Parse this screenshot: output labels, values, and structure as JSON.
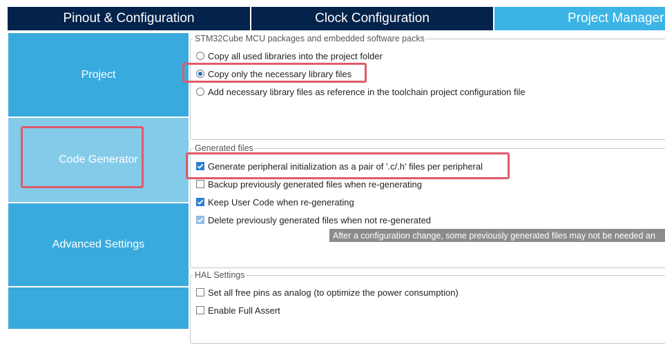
{
  "tabs": {
    "pinout": "Pinout & Configuration",
    "clock": "Clock Configuration",
    "project_manager": "Project Manager"
  },
  "sidebar": {
    "items": [
      {
        "label": "Project"
      },
      {
        "label": "Code Generator"
      },
      {
        "label": "Advanced Settings"
      },
      {
        "label": ""
      }
    ]
  },
  "packages": {
    "legend": "STM32Cube MCU packages and embedded software packs",
    "options": [
      {
        "label": "Copy all used libraries into the project folder",
        "selected": false
      },
      {
        "label": "Copy only the necessary library files",
        "selected": true
      },
      {
        "label": "Add necessary library files as reference in the toolchain project configuration file",
        "selected": false
      }
    ]
  },
  "generated_files": {
    "legend": "Generated files",
    "options": [
      {
        "label": "Generate peripheral initialization as a pair of '.c/.h' files per peripheral",
        "checked": true
      },
      {
        "label": "Backup previously generated files when re-generating",
        "checked": false
      },
      {
        "label": "Keep User Code when re-generating",
        "checked": true
      },
      {
        "label": "Delete previously generated files when not re-generated",
        "checked": true
      }
    ],
    "tooltip": "After a configuration change, some previously generated files may not be needed an"
  },
  "hal_settings": {
    "legend": "HAL Settings",
    "options": [
      {
        "label": "Set all free pins as analog (to optimize the power consumption)",
        "checked": false
      },
      {
        "label": "Enable Full Assert",
        "checked": false
      }
    ]
  },
  "colors": {
    "tab_dark": "#03234b",
    "tab_active": "#3cb4e6",
    "sidebar": "#39aadd",
    "sidebar_selected": "#84cbea",
    "highlight": "#e05a6a"
  }
}
